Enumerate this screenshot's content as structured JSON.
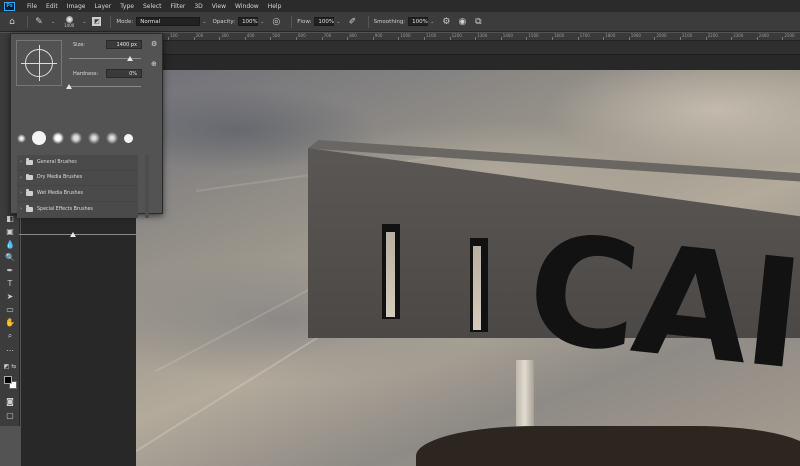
{
  "menubar": {
    "logo": "Ps",
    "items": [
      "File",
      "Edit",
      "Image",
      "Layer",
      "Type",
      "Select",
      "Filter",
      "3D",
      "View",
      "Window",
      "Help"
    ]
  },
  "options": {
    "brush_size": "1400",
    "mode_label": "Mode:",
    "mode_value": "Normal",
    "opacity_label": "Opacity:",
    "opacity_value": "100%",
    "flow_label": "Flow:",
    "flow_value": "100%",
    "smoothing_label": "Smoothing:",
    "smoothing_value": "100%"
  },
  "ruler": {
    "ticks": [
      "100",
      "200",
      "300",
      "400",
      "500",
      "600",
      "700",
      "800",
      "900",
      "1000",
      "1100",
      "1200",
      "1300",
      "1400",
      "1500",
      "1600",
      "1700",
      "1800",
      "1900",
      "2000",
      "2100",
      "2200",
      "2300",
      "2400",
      "2500"
    ]
  },
  "brush_picker": {
    "size_label": "Size:",
    "size_value": "1400 px",
    "hardness_label": "Hardness:",
    "hardness_value": "0%",
    "size_level": 0.85,
    "hardness_level": 0.0,
    "folders": [
      "General Brushes",
      "Dry Media Brushes",
      "Wet Media Brushes",
      "Special Effects Brushes"
    ]
  },
  "canvas": {
    "sign_letters": "CAI"
  },
  "colors": {
    "foreground": "#000000",
    "background": "#ffffff"
  }
}
